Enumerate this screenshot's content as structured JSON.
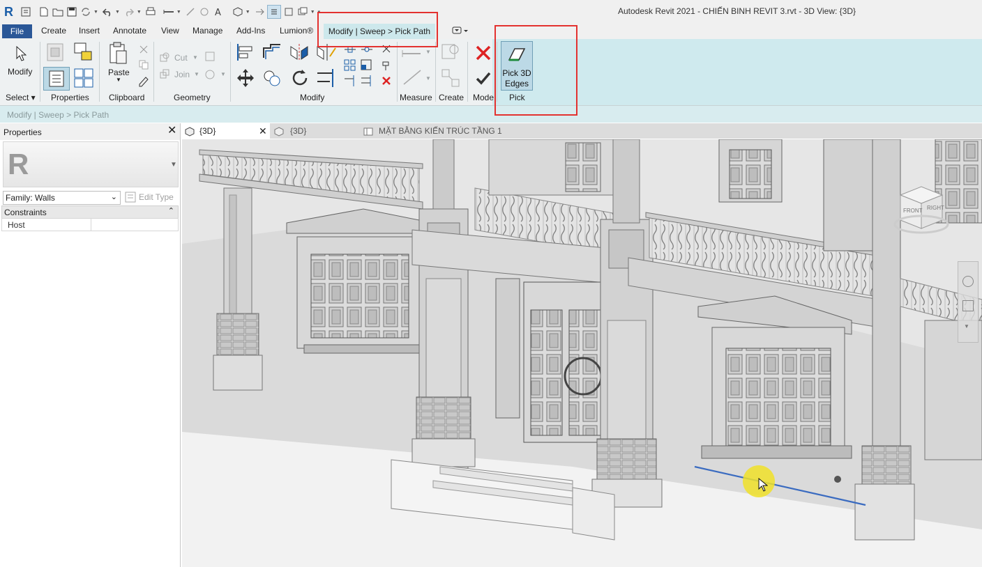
{
  "window": {
    "title": "Autodesk Revit 2021 - CHIẾN BINH REVIT 3.rvt - 3D View: {3D}",
    "logo": "R"
  },
  "menu": {
    "tabs": [
      "File",
      "Create",
      "Insert",
      "Annotate",
      "View",
      "Manage",
      "Add-Ins",
      "Lumion®"
    ],
    "context_tab": "Modify | Sweep > Pick Path"
  },
  "ribbon": {
    "groups": {
      "select": "Select ▾",
      "properties": "Properties",
      "clipboard": "Clipboard",
      "geometry": "Geometry",
      "modify": "Modify",
      "measure": "Measure",
      "create": "Create",
      "mode": "Mode",
      "pick": "Pick"
    },
    "buttons": {
      "modify": "Modify",
      "paste": "Paste",
      "cut": "Cut",
      "join": "Join",
      "pick_3d_edges_line1": "Pick 3D",
      "pick_3d_edges_line2": "Edges"
    }
  },
  "options_bar": {
    "path": "Modify | Sweep > Pick Path"
  },
  "properties": {
    "title": "Properties",
    "family": "Family: Walls",
    "edit_type": "Edit Type",
    "section": "Constraints",
    "rows": [
      {
        "label": "Host",
        "value": ""
      }
    ]
  },
  "view_tabs": [
    {
      "label": "{3D}",
      "active": true
    },
    {
      "label": "{3D}",
      "active": false
    },
    {
      "label": "MẶT BẰNG KIẾN TRÚC TẦNG 1",
      "active": false
    }
  ],
  "viewcube": {
    "front": "FRONT",
    "right": "RIGHT"
  },
  "colors": {
    "file_tab": "#2b5797",
    "context_tab": "#cde8ec",
    "highlight_box": "#e3312f",
    "cursor_highlight": "#f0e128"
  }
}
